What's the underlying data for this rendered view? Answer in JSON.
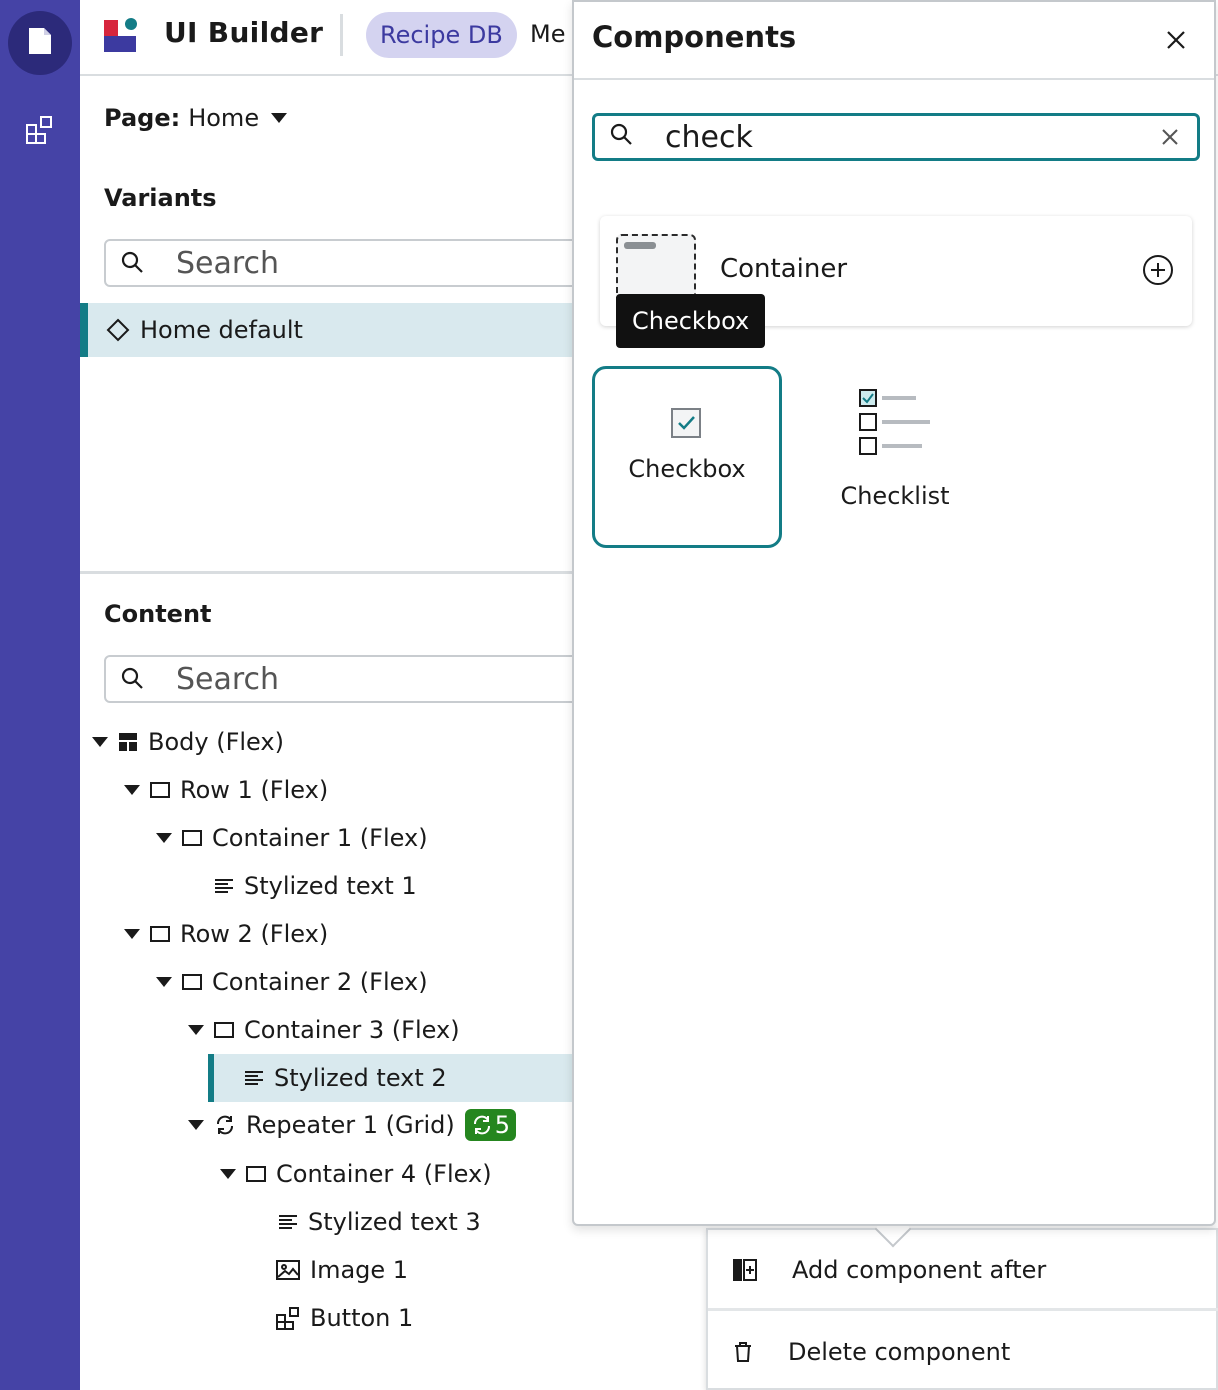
{
  "app": {
    "title": "UI Builder",
    "project_chip": "Recipe DB",
    "header_more": "Me",
    "colors": {
      "rail": "#4543a6",
      "accent": "#137c86",
      "chip_bg": "#d4d3f0",
      "selection_bg": "#d9e9ee",
      "badge": "#25861f"
    }
  },
  "rail": {
    "items": [
      {
        "icon": "page-icon",
        "active": true
      },
      {
        "icon": "components-icon",
        "active": false
      }
    ]
  },
  "left": {
    "page_label": "Page:",
    "page_value": "Home",
    "variants_title": "Variants",
    "variants_search_placeholder": "Search",
    "variant_selected": "Home default",
    "content_title": "Content",
    "content_search_placeholder": "Search",
    "tree": [
      {
        "label": "Body (Flex)",
        "icon": "layout-icon",
        "expanded": true
      },
      {
        "label": "Row 1 (Flex)",
        "icon": "box-icon",
        "expanded": true
      },
      {
        "label": "Container 1 (Flex)",
        "icon": "box-icon",
        "expanded": true
      },
      {
        "label": "Stylized text 1",
        "icon": "text-icon"
      },
      {
        "label": "Row 2 (Flex)",
        "icon": "box-icon",
        "expanded": true
      },
      {
        "label": "Container 2 (Flex)",
        "icon": "box-icon",
        "expanded": true
      },
      {
        "label": "Container 3 (Flex)",
        "icon": "box-icon",
        "expanded": true
      },
      {
        "label": "Stylized text 2",
        "icon": "text-icon",
        "selected": true
      },
      {
        "label": "Repeater 1 (Grid)",
        "icon": "repeat-icon",
        "expanded": true,
        "badge": "5"
      },
      {
        "label": "Container 4 (Flex)",
        "icon": "box-icon",
        "expanded": true
      },
      {
        "label": "Stylized text 3",
        "icon": "text-icon"
      },
      {
        "label": "Image 1",
        "icon": "image-icon"
      },
      {
        "label": "Button 1",
        "icon": "button-icon"
      }
    ]
  },
  "context_menu": {
    "add_after": "Add component after",
    "delete": "Delete component"
  },
  "components": {
    "title": "Components",
    "search_value": "check",
    "container_label": "Container",
    "tooltip": "Checkbox",
    "tiles": [
      {
        "label": "Checkbox",
        "icon": "checkbox-icon",
        "selected": true
      },
      {
        "label": "Checklist",
        "icon": "checklist-icon"
      }
    ]
  }
}
